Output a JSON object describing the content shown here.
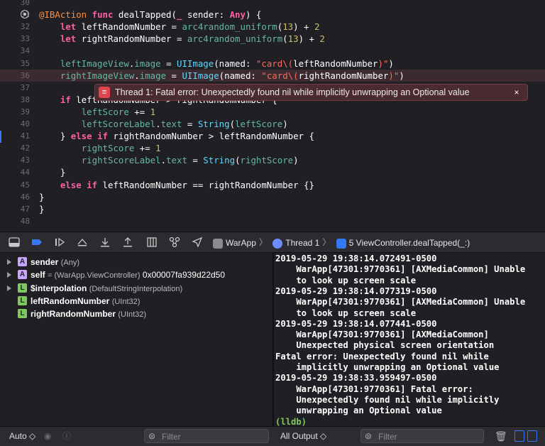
{
  "editor": {
    "lines": [
      {
        "num": "30",
        "tokens": []
      },
      {
        "num": "31",
        "breakpoint": true,
        "tokens": [
          {
            "c": "attr",
            "t": "@IBAction"
          },
          {
            "c": "pl",
            "t": " "
          },
          {
            "c": "kw",
            "t": "func"
          },
          {
            "c": "pl",
            "t": " dealTapped("
          },
          {
            "c": "kw",
            "t": "_"
          },
          {
            "c": "pl",
            "t": " sender: "
          },
          {
            "c": "kw",
            "t": "Any"
          },
          {
            "c": "pl",
            "t": ") {"
          }
        ]
      },
      {
        "num": "32",
        "tokens": [
          {
            "c": "pl",
            "t": "    "
          },
          {
            "c": "kw",
            "t": "let"
          },
          {
            "c": "pl",
            "t": " leftRandomNumber = "
          },
          {
            "c": "prop",
            "t": "arc4random_uniform"
          },
          {
            "c": "pl",
            "t": "("
          },
          {
            "c": "num",
            "t": "13"
          },
          {
            "c": "pl",
            "t": ") + "
          },
          {
            "c": "num",
            "t": "2"
          }
        ]
      },
      {
        "num": "33",
        "tokens": [
          {
            "c": "pl",
            "t": "    "
          },
          {
            "c": "kw",
            "t": "let"
          },
          {
            "c": "pl",
            "t": " rightRandomNumber = "
          },
          {
            "c": "prop",
            "t": "arc4random_uniform"
          },
          {
            "c": "pl",
            "t": "("
          },
          {
            "c": "num",
            "t": "13"
          },
          {
            "c": "pl",
            "t": ") + "
          },
          {
            "c": "num",
            "t": "2"
          }
        ]
      },
      {
        "num": "34",
        "tokens": []
      },
      {
        "num": "35",
        "tokens": [
          {
            "c": "pl",
            "t": "    "
          },
          {
            "c": "prop",
            "t": "leftImageView"
          },
          {
            "c": "pl",
            "t": "."
          },
          {
            "c": "prop",
            "t": "image"
          },
          {
            "c": "pl",
            "t": " = "
          },
          {
            "c": "ty",
            "t": "UIImage"
          },
          {
            "c": "pl",
            "t": "(named: "
          },
          {
            "c": "str",
            "t": "\"card\\("
          },
          {
            "c": "pl",
            "t": "leftRandomNumber"
          },
          {
            "c": "str",
            "t": ")\""
          },
          {
            "c": "pl",
            "t": ")"
          }
        ]
      },
      {
        "num": "36",
        "highlight": true,
        "tokens": [
          {
            "c": "pl",
            "t": "    "
          },
          {
            "c": "prop",
            "t": "rightImageView"
          },
          {
            "c": "pl",
            "t": "."
          },
          {
            "c": "prop",
            "t": "image"
          },
          {
            "c": "pl",
            "t": " = "
          },
          {
            "c": "ty",
            "t": "UIImage"
          },
          {
            "c": "pl",
            "t": "(named: "
          },
          {
            "c": "str",
            "t": "\"card\\("
          },
          {
            "c": "pl",
            "t": "rightRandomNumber"
          },
          {
            "c": "str",
            "t": ")\""
          },
          {
            "c": "pl",
            "t": ")"
          }
        ]
      },
      {
        "num": "37",
        "tokens": []
      },
      {
        "num": "38",
        "tokens": [
          {
            "c": "pl",
            "t": "    "
          },
          {
            "c": "kw",
            "t": "if"
          },
          {
            "c": "pl",
            "t": " leftRandomNumber > rightRandomNumber {"
          }
        ]
      },
      {
        "num": "39",
        "tokens": [
          {
            "c": "pl",
            "t": "        "
          },
          {
            "c": "prop",
            "t": "leftScore"
          },
          {
            "c": "pl",
            "t": " += "
          },
          {
            "c": "num",
            "t": "1"
          }
        ]
      },
      {
        "num": "40",
        "tokens": [
          {
            "c": "pl",
            "t": "        "
          },
          {
            "c": "prop",
            "t": "leftScoreLabel"
          },
          {
            "c": "pl",
            "t": "."
          },
          {
            "c": "prop",
            "t": "text"
          },
          {
            "c": "pl",
            "t": " = "
          },
          {
            "c": "ty",
            "t": "String"
          },
          {
            "c": "pl",
            "t": "("
          },
          {
            "c": "prop",
            "t": "leftScore"
          },
          {
            "c": "pl",
            "t": ")"
          }
        ]
      },
      {
        "num": "41",
        "tokens": [
          {
            "c": "pl",
            "t": "    } "
          },
          {
            "c": "kw",
            "t": "else"
          },
          {
            "c": "pl",
            "t": " "
          },
          {
            "c": "kw",
            "t": "if"
          },
          {
            "c": "pl",
            "t": " rightRandomNumber > leftRandomNumber {"
          }
        ]
      },
      {
        "num": "42",
        "tokens": [
          {
            "c": "pl",
            "t": "        "
          },
          {
            "c": "prop",
            "t": "rightScore"
          },
          {
            "c": "pl",
            "t": " += "
          },
          {
            "c": "num",
            "t": "1"
          }
        ]
      },
      {
        "num": "43",
        "tokens": [
          {
            "c": "pl",
            "t": "        "
          },
          {
            "c": "prop",
            "t": "rightScoreLabel"
          },
          {
            "c": "pl",
            "t": "."
          },
          {
            "c": "prop",
            "t": "text"
          },
          {
            "c": "pl",
            "t": " = "
          },
          {
            "c": "ty",
            "t": "String"
          },
          {
            "c": "pl",
            "t": "("
          },
          {
            "c": "prop",
            "t": "rightScore"
          },
          {
            "c": "pl",
            "t": ")"
          }
        ]
      },
      {
        "num": "44",
        "tokens": [
          {
            "c": "pl",
            "t": "    }"
          }
        ]
      },
      {
        "num": "45",
        "tokens": [
          {
            "c": "pl",
            "t": "    "
          },
          {
            "c": "kw",
            "t": "else"
          },
          {
            "c": "pl",
            "t": " "
          },
          {
            "c": "kw",
            "t": "if"
          },
          {
            "c": "pl",
            "t": " leftRandomNumber == rightRandomNumber {}"
          }
        ]
      },
      {
        "num": "46",
        "tokens": [
          {
            "c": "pl",
            "t": "}"
          }
        ]
      },
      {
        "num": "47",
        "tokens": [
          {
            "c": "pl",
            "t": "}"
          }
        ]
      },
      {
        "num": "48",
        "tokens": []
      }
    ],
    "error_banner": {
      "icon": "error-list-icon",
      "message": "Thread 1: Fatal error: Unexpectedly found nil while implicitly unwrapping an Optional value",
      "close": "×"
    }
  },
  "debug_bar": {
    "buttons": [
      "hide-debug-area-icon",
      "breakpoints-toggle-icon",
      "continue-icon",
      "step-over-icon",
      "step-into-icon",
      "step-out-icon",
      "view-hierarchy-icon",
      "memory-graph-icon",
      "simulate-location-icon"
    ],
    "breadcrumbs": [
      {
        "icon": "app-icon",
        "label": "WarApp"
      },
      {
        "icon": "thread-icon",
        "label": "Thread 1"
      },
      {
        "icon": "frame-icon",
        "label": "5 ViewController.dealTapped(_:)"
      }
    ]
  },
  "variables": [
    {
      "expandable": true,
      "kind": "A",
      "name": "sender",
      "type": "(Any)",
      "value": ""
    },
    {
      "expandable": true,
      "kind": "A",
      "name": "self",
      "type": "= (WarApp.ViewController)",
      "value": "0x00007fa939d22d50"
    },
    {
      "expandable": true,
      "kind": "L",
      "name": "$interpolation",
      "type": "(DefaultStringInterpolation)",
      "value": ""
    },
    {
      "expandable": false,
      "kind": "L",
      "name": "leftRandomNumber",
      "type": "(UInt32)",
      "value": ""
    },
    {
      "expandable": false,
      "kind": "L",
      "name": "rightRandomNumber",
      "type": "(UInt32)",
      "value": ""
    }
  ],
  "console": {
    "lines": [
      "2019-05-29 19:38:14.072491-0500",
      "    WarApp[47301:9770361] [AXMediaCommon] Unable",
      "    to look up screen scale",
      "2019-05-29 19:38:14.077319-0500",
      "    WarApp[47301:9770361] [AXMediaCommon] Unable",
      "    to look up screen scale",
      "2019-05-29 19:38:14.077441-0500",
      "    WarApp[47301:9770361] [AXMediaCommon]",
      "    Unexpected physical screen orientation",
      "Fatal error: Unexpectedly found nil while",
      "    implicitly unwrapping an Optional value",
      "2019-05-29 19:38:33.959497-0500",
      "    WarApp[47301:9770361] Fatal error:",
      "    Unexpectedly found nil while implicitly",
      "    unwrapping an Optional value"
    ],
    "prompt": "(lldb)"
  },
  "bottom_bar": {
    "left_selector": "Auto ◇",
    "left_filter_placeholder": "Filter",
    "output_selector": "All Output ◇",
    "right_filter_placeholder": "Filter"
  },
  "colors": {
    "keyword": "#fc5fa3",
    "attribute": "#fd8f3f",
    "type": "#5dd8ff",
    "property": "#67b7a4",
    "number": "#d0bf69",
    "string": "#fc6a5d",
    "error": "#e0454e",
    "accent": "#3478f6"
  }
}
